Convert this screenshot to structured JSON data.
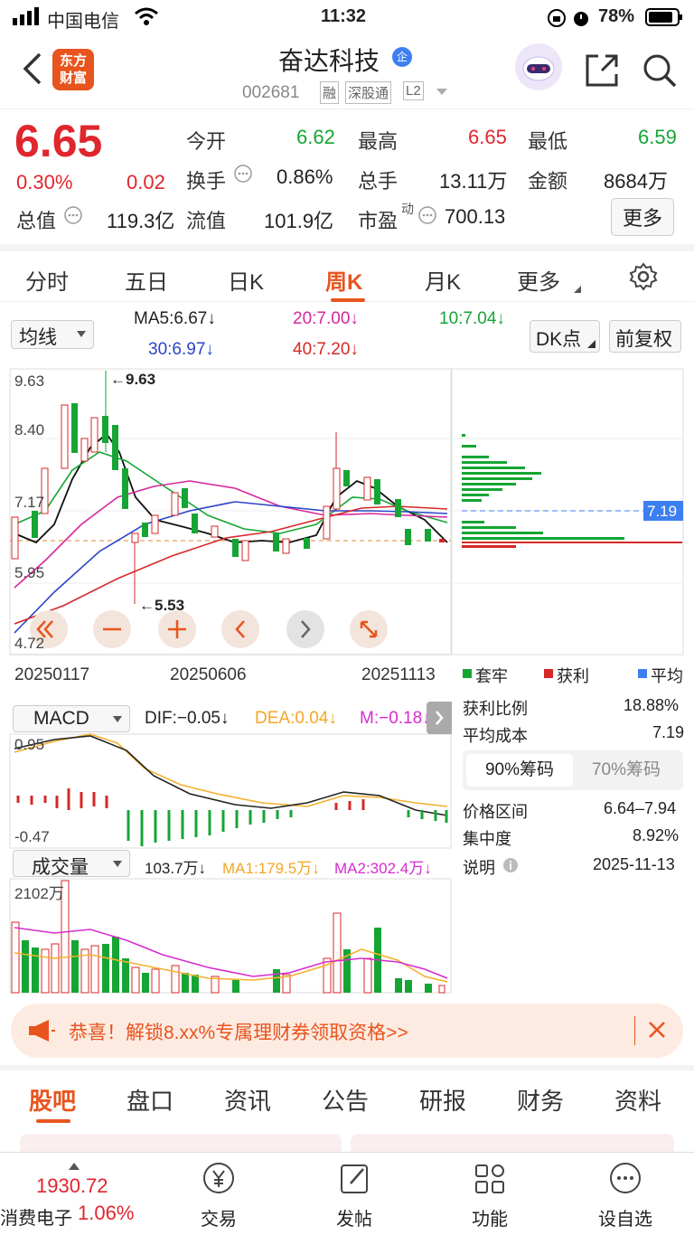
{
  "status": {
    "carrier": "中国电信",
    "time": "11:32",
    "battery": "78%"
  },
  "header": {
    "logo_line1": "东方",
    "logo_line2": "财富",
    "name": "奋达科技",
    "badge": "企",
    "code": "002681",
    "tags": [
      "融",
      "深股通",
      "L2"
    ]
  },
  "quote": {
    "price": "6.65",
    "pct": "0.30%",
    "chg": "0.02",
    "open_l": "今开",
    "open_v": "6.62",
    "high_l": "最高",
    "high_v": "6.65",
    "low_l": "最低",
    "low_v": "6.59",
    "turn_l": "换手",
    "turn_v": "0.86%",
    "vol_l": "总手",
    "vol_v": "13.11万",
    "amt_l": "金额",
    "amt_v": "8684万",
    "mcap_l": "总值",
    "mcap_v": "119.3亿",
    "fcap_l": "流值",
    "fcap_v": "101.9亿",
    "pe_l": "市盈",
    "pe_sup": "动",
    "pe_v": "700.13",
    "more": "更多"
  },
  "tabs": [
    "分时",
    "五日",
    "日K",
    "周K",
    "月K",
    "更多"
  ],
  "indicators": {
    "sel": "均线",
    "ma5": "MA5:6.67↓",
    "ma20": "20:7.00↓",
    "ma10": "10:7.04↓",
    "ma30": "30:6.97↓",
    "ma40": "40:7.20↓",
    "dk": "DK点",
    "fq": "前复权"
  },
  "axis": {
    "y1": "9.63",
    "y2": "8.40",
    "y3": "7.17",
    "y4": "5.95",
    "y5": "4.72",
    "hi": "←9.63",
    "lo": "←5.53",
    "d1": "20250117",
    "d2": "20250606",
    "d3": "20251113"
  },
  "chip": {
    "price_tag": "7.19",
    "leg1": "套牢",
    "leg2": "获利",
    "leg3": "平均",
    "r1l": "获利比例",
    "r1v": "18.88%",
    "r2l": "平均成本",
    "r2v": "7.19",
    "t90": "90%筹码",
    "t70": "70%筹码",
    "r3l": "价格区间",
    "r3v": "6.64–7.94",
    "r4l": "集中度",
    "r4v": "8.92%",
    "r5l": "说明",
    "r5v": "2025-11-13"
  },
  "macd": {
    "sel": "MACD",
    "dif": "DIF:−0.05↓",
    "dea": "DEA:0.04↓",
    "m": "M:−0.18↓",
    "top": "0.95",
    "bot": "-0.47"
  },
  "volume": {
    "sel": "成交量",
    "v": "103.7万↓",
    "ma1": "MA1:179.5万↓",
    "ma2": "MA2:302.4万↓",
    "top": "2102万"
  },
  "banner": "恭喜！解锁8.xx%专属理财券领取资格>>",
  "bottom_tabs": [
    "股吧",
    "盘口",
    "资讯",
    "公告",
    "研报",
    "财务",
    "资料"
  ],
  "nav": {
    "idx_val": "1930.72",
    "idx_name": "消费电子",
    "idx_pct": "1.06%",
    "n1": "交易",
    "n2": "发帖",
    "n3": "功能",
    "n4": "设自选"
  },
  "colors": {
    "red": "#e0262d",
    "green": "#16a534",
    "accent": "#e8541e"
  }
}
